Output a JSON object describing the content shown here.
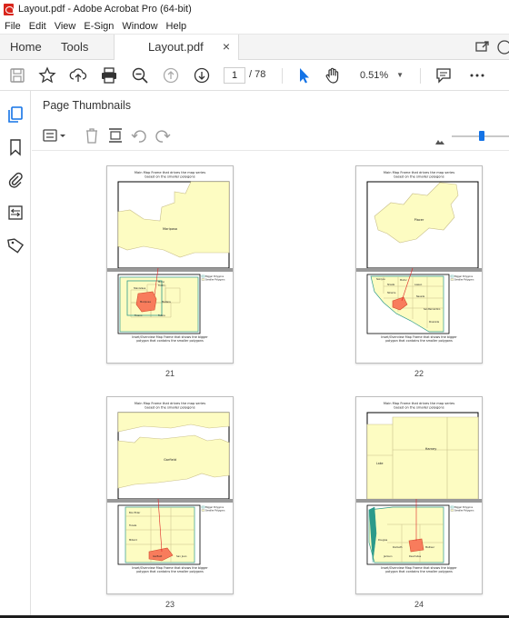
{
  "window": {
    "title": "Layout.pdf - Adobe Acrobat Pro (64-bit)"
  },
  "menu": [
    "File",
    "Edit",
    "View",
    "E-Sign",
    "Window",
    "Help"
  ],
  "tabs": {
    "home": "Home",
    "tools": "Tools",
    "document": "Layout.pdf",
    "close": "×"
  },
  "toolbar": {
    "page_current": "1",
    "page_total": "/ 78",
    "zoom": "0.51%",
    "zoom_caret": "▼"
  },
  "panel": {
    "title": "Page Thumbnails"
  },
  "thumb_text": {
    "title_line1": "Main Map Frame that drives the map series",
    "title_line2": "based on the smaller polygons",
    "legend_bigger": "Bigger Polygons",
    "legend_smaller": "Smaller Polygons",
    "caption_line1": "Inset/Overview Map Frame that shows the bigger",
    "caption_line2": "polygon that contains the smaller polygons"
  },
  "thumbnails": [
    {
      "page": "21",
      "main_label": "Mariposa",
      "inset_labels": [
        "Mono",
        "Tuolu..",
        "Mariposa",
        "Madera",
        "Merced",
        "Fresno",
        "Stanislaus",
        "Tulare",
        "Inyo"
      ]
    },
    {
      "page": "22",
      "main_label": "Placer",
      "inset_labels": [
        "Siskiyou",
        "Modoc",
        "Shasta",
        "Lassen",
        "Tehama",
        "Butte",
        "Plumas",
        "Sierra",
        "Nevada",
        "Placer",
        "El Dorado",
        "Alpine",
        "Mono",
        "Inyo",
        "San Bernardino",
        "Riverside",
        "Kern"
      ]
    },
    {
      "page": "23",
      "main_label": "Garfield",
      "inset_labels": [
        "Box Elder",
        "Tooele",
        "Millard",
        "Garfield",
        "San Juan"
      ]
    },
    {
      "page": "24",
      "main_label": "Harney",
      "inset_labels": [
        "Lake",
        "Harney",
        "Douglas",
        "Klamath",
        "Jackson",
        "Malheur",
        "Lane",
        "Deschutes"
      ]
    }
  ],
  "colors": {
    "accent": "#1473e6",
    "map_fill": "#fdfcc2",
    "highlight": "#f87c5c",
    "brand_red": "#d9261c"
  }
}
